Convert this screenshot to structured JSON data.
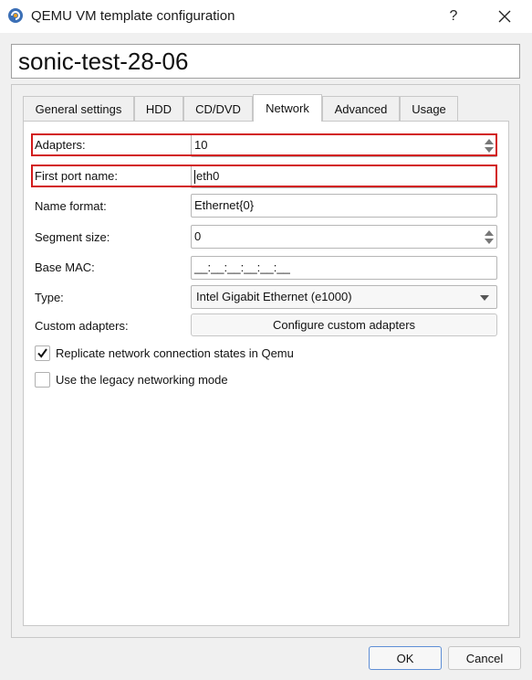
{
  "window": {
    "title": "QEMU VM template configuration",
    "help_label": "?",
    "close_label": "✕"
  },
  "vm_name": "sonic-test-28-06",
  "tabs": [
    {
      "label": "General settings"
    },
    {
      "label": "HDD"
    },
    {
      "label": "CD/DVD"
    },
    {
      "label": "Network",
      "active": true
    },
    {
      "label": "Advanced"
    },
    {
      "label": "Usage"
    }
  ],
  "network": {
    "adapters": {
      "label": "Adapters:",
      "value": "10"
    },
    "first_port_name": {
      "label": "First port name:",
      "value": "eth0"
    },
    "name_format": {
      "label": "Name format:",
      "value": "Ethernet{0}"
    },
    "segment_size": {
      "label": "Segment size:",
      "value": "0"
    },
    "base_mac": {
      "label": "Base MAC:",
      "value": "__:__:__:__:__:__"
    },
    "type": {
      "label": "Type:",
      "value": "Intel Gigabit Ethernet (e1000)"
    },
    "custom_adapters": {
      "label": "Custom adapters:",
      "button": "Configure custom adapters"
    },
    "replicate": {
      "label": "Replicate network connection states in Qemu",
      "checked": true
    },
    "legacy": {
      "label": "Use the legacy networking mode",
      "checked": false
    }
  },
  "buttons": {
    "ok": "OK",
    "cancel": "Cancel"
  },
  "colors": {
    "highlight": "#d21a1a",
    "default_button_border": "#5f8fd6"
  },
  "icons": {
    "app": "qemu-gns3-icon",
    "spin_up": "triangle-up",
    "spin_down": "triangle-down",
    "dropdown": "triangle-down",
    "check": "checkmark"
  }
}
